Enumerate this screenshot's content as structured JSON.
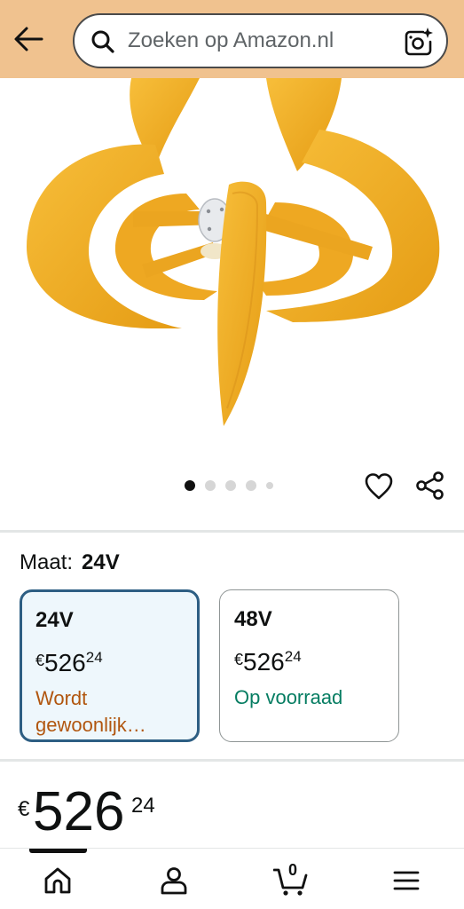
{
  "header": {
    "back_icon": "arrow-left-icon",
    "search_placeholder": "Zoeken op Amazon.nl",
    "search_icon": "search-icon",
    "camera_icon": "camera-sparkle-icon"
  },
  "product": {
    "image_alt_icon": "product-image",
    "image_count": 5,
    "active_image_index": 0,
    "favorite_icon": "heart-icon",
    "share_icon": "share-icon"
  },
  "size_selector": {
    "label": "Maat:",
    "selected_value": "24V",
    "options": [
      {
        "size": "24V",
        "currency": "€",
        "price_whole": "526",
        "price_cents": "24",
        "status": "Wordt gewoonlijk…",
        "selected": true
      },
      {
        "size": "48V",
        "currency": "€",
        "price_whole": "526",
        "price_cents": "24",
        "status": "Op voorraad",
        "selected": false
      }
    ]
  },
  "price": {
    "currency": "€",
    "whole": "526",
    "cents": "24"
  },
  "bottom_nav": {
    "items": [
      "home-icon",
      "account-icon",
      "cart-icon",
      "menu-icon"
    ],
    "cart_count": "0",
    "active_index": 0
  },
  "colors": {
    "header_bg": "#f0c28f",
    "selected_border": "#2d5e83",
    "selected_bg": "#eef7fc",
    "status_warn": "#b1560f",
    "status_ok": "#067d62",
    "blade_yellow": "#f2ae1e"
  }
}
